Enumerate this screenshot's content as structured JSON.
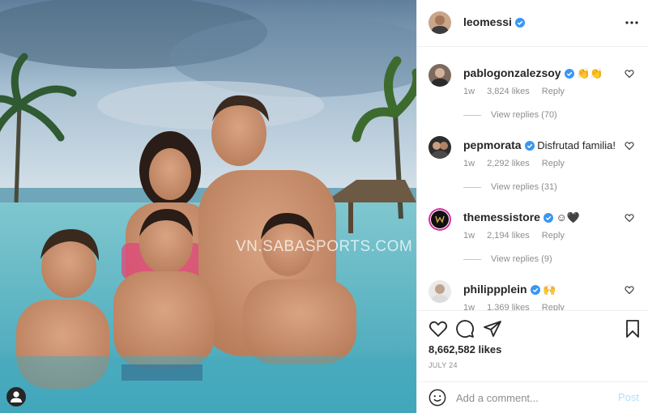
{
  "photo": {
    "alt": "Family photo in a pool",
    "watermark": "VN.SABASPORTS.COM"
  },
  "post": {
    "username": "leomessi",
    "verified": true,
    "likes": "8,662,582 likes",
    "date": "JULY 24"
  },
  "comments": [
    {
      "username": "pablogonzalezsoy",
      "verified": true,
      "text": "👏👏",
      "age": "1w",
      "likes": "3,824 likes",
      "reply": "Reply",
      "view_replies": "View replies (70)"
    },
    {
      "username": "pepmorata",
      "verified": true,
      "text": "Disfrutad familia!",
      "age": "1w",
      "likes": "2,292 likes",
      "reply": "Reply",
      "view_replies": "View replies (31)"
    },
    {
      "username": "themessistore",
      "verified": true,
      "text": "☺🖤",
      "age": "1w",
      "likes": "2,194 likes",
      "reply": "Reply",
      "view_replies": "View replies (9)"
    },
    {
      "username": "philippplein",
      "verified": true,
      "text": "🙌",
      "age": "1w",
      "likes": "1,369 likes",
      "reply": "Reply",
      "view_replies": ""
    }
  ],
  "add_comment": {
    "placeholder": "Add a comment...",
    "post_label": "Post"
  },
  "colors": {
    "accent": "#3897f0",
    "post_disabled": "#b2dffc",
    "muted_text": "#8e8e8e"
  },
  "icons": [
    "more-icon",
    "heart-icon",
    "comment-icon",
    "share-icon",
    "bookmark-icon",
    "emoji-icon",
    "user-tag-icon",
    "verified-badge-icon"
  ]
}
